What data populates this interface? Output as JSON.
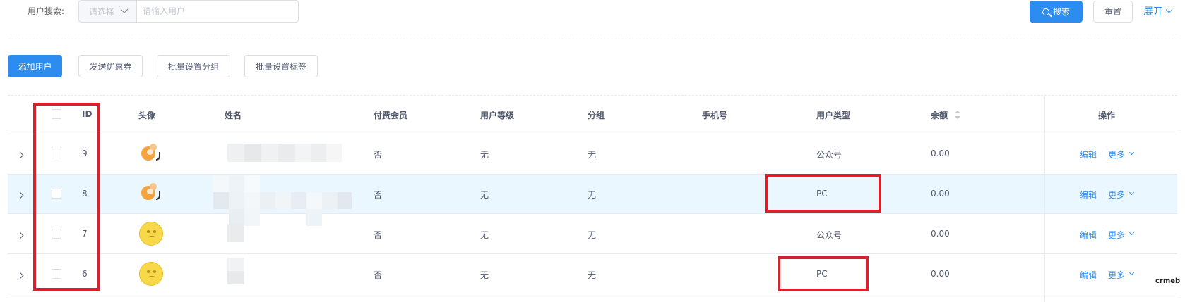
{
  "search": {
    "label": "用户搜索:",
    "select_placeholder": "请选择",
    "input_placeholder": "请输入用户",
    "search_button": "搜索",
    "reset_button": "重置",
    "expand_label": "展开"
  },
  "actions": {
    "add_user": "添加用户",
    "send_coupon": "发送优惠券",
    "batch_group": "批量设置分组",
    "batch_tag": "批量设置标签"
  },
  "table": {
    "columns": {
      "id": "ID",
      "avatar": "头像",
      "name": "姓名",
      "paid_member": "付费会员",
      "user_level": "用户等级",
      "group": "分组",
      "phone": "手机号",
      "user_type": "用户类型",
      "balance": "余额",
      "operation": "操作"
    },
    "rows": [
      {
        "id": "9",
        "avatar": "orange-cartoon",
        "paid_member": "否",
        "user_level": "无",
        "group": "无",
        "phone": "",
        "user_type": "公众号",
        "balance": "0.00",
        "edit": "编辑",
        "more": "更多"
      },
      {
        "id": "8",
        "avatar": "orange-cartoon",
        "paid_member": "否",
        "user_level": "无",
        "group": "无",
        "phone": "",
        "user_type": "PC",
        "balance": "0.00",
        "edit": "编辑",
        "more": "更多"
      },
      {
        "id": "7",
        "avatar": "sad-face",
        "paid_member": "否",
        "user_level": "无",
        "group": "无",
        "phone": "",
        "user_type": "公众号",
        "balance": "0.00",
        "edit": "编辑",
        "more": "更多"
      },
      {
        "id": "6",
        "avatar": "sad-face",
        "paid_member": "否",
        "user_level": "无",
        "group": "无",
        "phone": "",
        "user_type": "PC",
        "balance": "0.00",
        "edit": "编辑",
        "more": "更多"
      }
    ]
  },
  "colors": {
    "primary": "#2d8cf0",
    "highlight_row": "#ebf7ff",
    "annotation_red": "#d9212c"
  },
  "watermark": "crmeb"
}
